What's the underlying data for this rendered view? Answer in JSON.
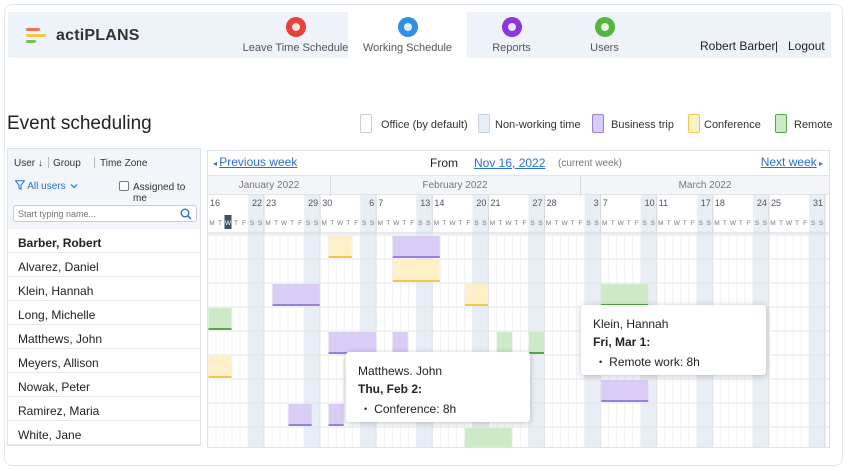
{
  "app": {
    "name": "actiPLANS"
  },
  "nav": [
    {
      "label": "Leave Time Schedule",
      "icon": "leave-time-icon",
      "color": "#e8403a"
    },
    {
      "label": "Working Schedule",
      "icon": "working-schedule-icon",
      "color": "#2f8fe6"
    },
    {
      "label": "Reports",
      "icon": "reports-icon",
      "color": "#8a38dd"
    },
    {
      "label": "Users",
      "icon": "users-icon",
      "color": "#55b63f"
    }
  ],
  "user": {
    "name": "Robert Barber",
    "separator": "|",
    "logout": "Logout"
  },
  "page": {
    "title": "Event scheduling"
  },
  "legend": [
    {
      "label": "Office (by default)",
      "color": "#ffffff",
      "border": "#c9ced6"
    },
    {
      "label": "Non-working time",
      "color": "#e8eef6",
      "border": "#c9d3e0"
    },
    {
      "label": "Business trip",
      "color": "#d9ccf5",
      "border": "#9b7fe0"
    },
    {
      "label": "Conference",
      "color": "#fdf0c8",
      "border": "#f0c84a"
    },
    {
      "label": "Remote",
      "color": "#cdeac7",
      "border": "#52a845"
    }
  ],
  "filters": {
    "user_label": "User",
    "user_sort": "↓",
    "group_label": "Group",
    "timezone_label": "Time Zone",
    "all_users": "All users",
    "assigned_to_me": "Assigned to me",
    "search_placeholder": "Start typing name..."
  },
  "users": [
    "Barber, Robert",
    "Alvarez, Daniel",
    "Klein, Hannah",
    "Long, Michelle",
    "Matthews, John",
    "Meyers, Allison",
    "Nowak, Peter",
    "Ramirez, Maria",
    "White, Jane"
  ],
  "calendar": {
    "prev_week": "Previous week",
    "next_week": "Next week",
    "from_label": "From",
    "from_date": "Nov 16, 2022",
    "current_week": "(current week)",
    "months": [
      "January 2022",
      "February 2022",
      "March 2022"
    ],
    "week_start_labels": [
      "16",
      "23",
      "30",
      "6",
      "13",
      "20",
      "27",
      "6",
      "13",
      "20",
      "27"
    ],
    "week_end_labels": [
      "22",
      "29",
      "6",
      "13",
      "20",
      "27",
      "3",
      "10",
      "17",
      "24",
      "31"
    ],
    "week_starts": [
      "16",
      "23",
      "30",
      "7",
      "14",
      "21",
      "28",
      "7",
      "11",
      "18",
      "25"
    ],
    "week_ends": [
      "22",
      "29",
      "6",
      "13",
      "20",
      "27",
      "3",
      "10",
      "17",
      "24",
      "31"
    ],
    "day_letters": [
      "M",
      "T",
      "W",
      "T",
      "F",
      "S",
      "S"
    ],
    "today_col": 2,
    "events": [
      {
        "row": 0,
        "start": 15,
        "len": 3,
        "type": "conference"
      },
      {
        "row": 0,
        "start": 23,
        "len": 6,
        "type": "trip"
      },
      {
        "row": 1,
        "start": 23,
        "len": 6,
        "type": "conference"
      },
      {
        "row": 2,
        "start": 8,
        "len": 6,
        "type": "trip"
      },
      {
        "row": 2,
        "start": 32,
        "len": 3,
        "type": "conference"
      },
      {
        "row": 2,
        "start": 49,
        "len": 6,
        "type": "remote"
      },
      {
        "row": 3,
        "start": 0,
        "len": 3,
        "type": "remote"
      },
      {
        "row": 4,
        "start": 15,
        "len": 6,
        "type": "trip"
      },
      {
        "row": 4,
        "start": 23,
        "len": 2,
        "type": "trip"
      },
      {
        "row": 4,
        "start": 36,
        "len": 2,
        "type": "remote"
      },
      {
        "row": 4,
        "start": 40,
        "len": 2,
        "type": "remote"
      },
      {
        "row": 5,
        "start": 0,
        "len": 3,
        "type": "conference"
      },
      {
        "row": 6,
        "start": 49,
        "len": 6,
        "type": "trip"
      },
      {
        "row": 7,
        "start": 10,
        "len": 3,
        "type": "trip"
      },
      {
        "row": 7,
        "start": 15,
        "len": 2,
        "type": "trip"
      },
      {
        "row": 8,
        "start": 32,
        "len": 6,
        "type": "remote"
      }
    ]
  },
  "tooltips": [
    {
      "name": "Matthews. John",
      "date": "Thu, Feb 2:",
      "item": "Conference: 8h"
    },
    {
      "name": "Klein, Hannah",
      "date": "Fri, Mar 1:",
      "item": "Remote work: 8h"
    }
  ]
}
